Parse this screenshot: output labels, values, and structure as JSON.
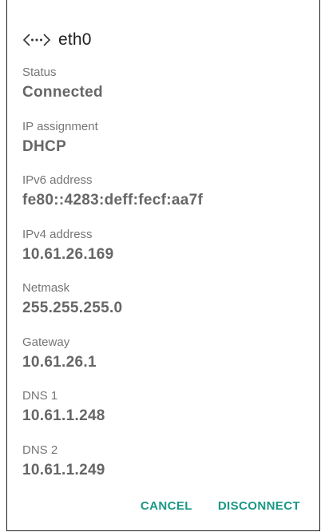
{
  "dialog": {
    "title": "eth0",
    "icon": "ethernet-icon"
  },
  "fields": [
    {
      "label": "Status",
      "value": "Connected"
    },
    {
      "label": "IP assignment",
      "value": "DHCP"
    },
    {
      "label": "IPv6 address",
      "value": "fe80::4283:deff:fecf:aa7f"
    },
    {
      "label": "IPv4 address",
      "value": "10.61.26.169"
    },
    {
      "label": "Netmask",
      "value": "255.255.255.0"
    },
    {
      "label": "Gateway",
      "value": "10.61.26.1"
    },
    {
      "label": "DNS 1",
      "value": "10.61.1.248"
    },
    {
      "label": "DNS 2",
      "value": "10.61.1.249"
    }
  ],
  "actions": {
    "cancel_label": "CANCEL",
    "disconnect_label": "DISCONNECT"
  },
  "colors": {
    "accent": "#1a9885",
    "value_text": "#666666",
    "label_text": "#757575",
    "title_text": "#202020"
  }
}
